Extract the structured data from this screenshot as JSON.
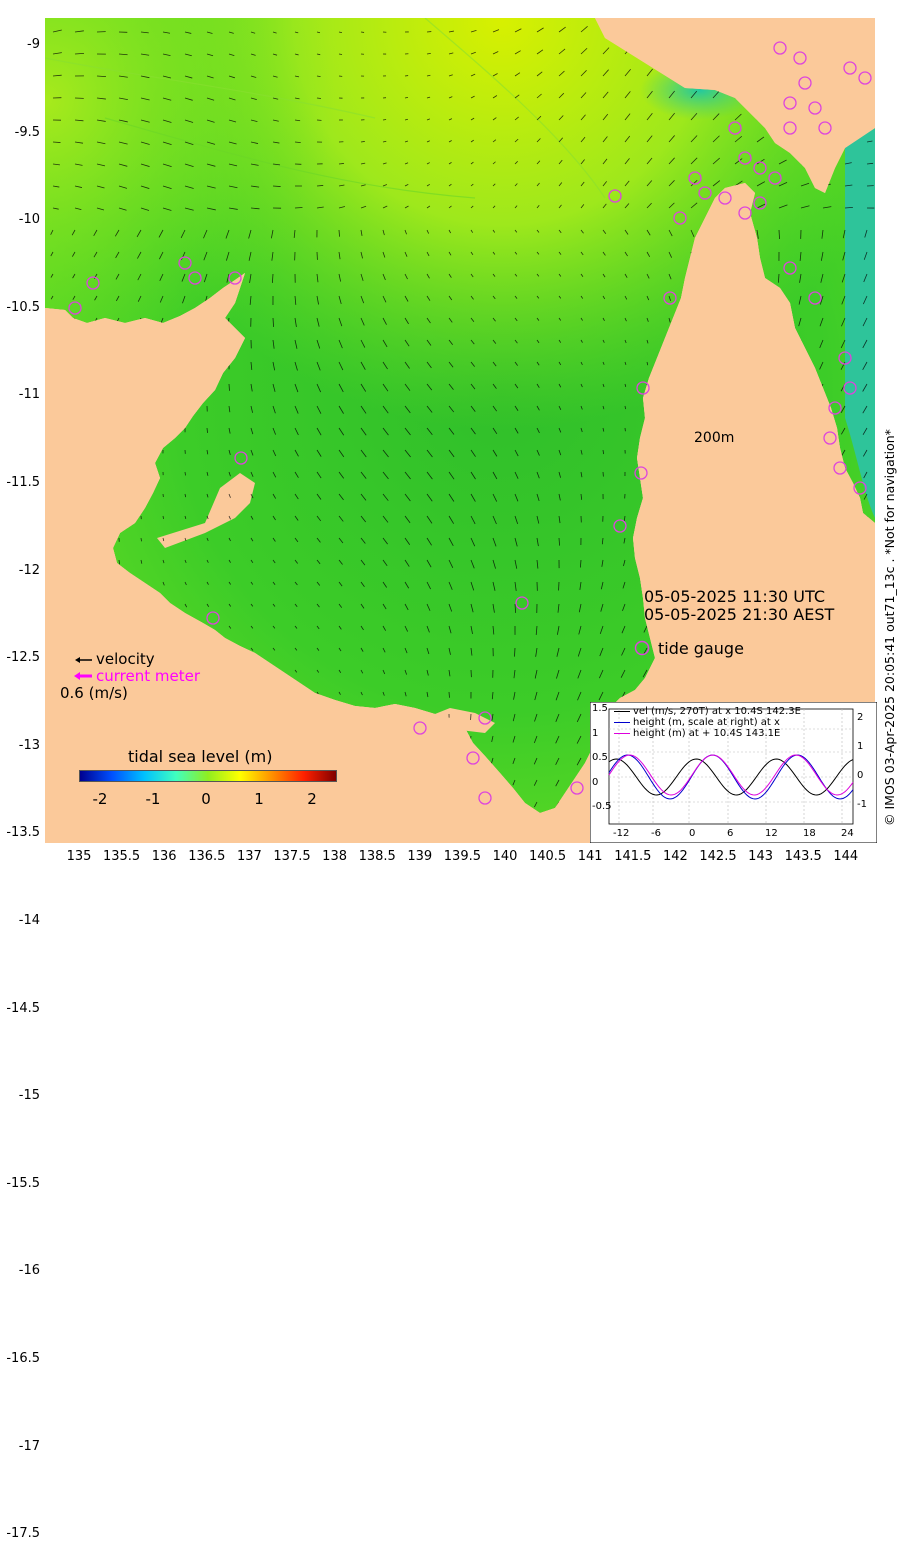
{
  "map": {
    "y_ticks": [
      "-9",
      "-9.5",
      "-10",
      "-10.5",
      "-11",
      "-11.5",
      "-12",
      "-12.5",
      "-13",
      "-13.5",
      "-14",
      "-14.5",
      "-15",
      "-15.5",
      "-16",
      "-16.5",
      "-17",
      "-17.5"
    ],
    "x_ticks": [
      "135",
      "135.5",
      "136",
      "136.5",
      "137",
      "137.5",
      "138",
      "138.5",
      "139",
      "139.5",
      "140",
      "140.5",
      "141",
      "141.5",
      "142",
      "142.5",
      "143",
      "143.5",
      "144"
    ],
    "lat_range": [
      -18.0,
      -8.75
    ],
    "lon_range": [
      134.7,
      144.2
    ],
    "scale_label": "200m",
    "timestamp_utc": "05-05-2025 11:30 UTC",
    "timestamp_local": "05-05-2025 21:30 AEST",
    "legend": {
      "tide_gauge": "tide gauge",
      "velocity": "velocity",
      "current_meter": "current meter",
      "speed_scale": "0.6 (m/s)"
    },
    "colorbar": {
      "title": "tidal sea level (m)",
      "ticks": [
        "-2",
        "-1",
        "0",
        "1",
        "2"
      ],
      "range": [
        -2.5,
        2.5
      ],
      "colors": [
        "#00008f",
        "#0050ff",
        "#00c0ff",
        "#40ffbf",
        "#90ee20",
        "#ffff00",
        "#ff9000",
        "#ff2000",
        "#800000"
      ]
    },
    "colors": {
      "land": "#fbc99a",
      "sea_level_zero": "#33cc22",
      "gauge_ring": "#dd44dd",
      "current_meter": "#ff00ff"
    },
    "credit": "© IMOS 03-Apr-2025 20:05:41 out71_13c . *Not for navigation*"
  },
  "inset": {
    "legend": [
      {
        "label": "vel (m/s, 270T) at x 10.4S 142.3E",
        "color": "#000000"
      },
      {
        "label": "height (m, scale at right) at x",
        "color": "#0000cc"
      },
      {
        "label": "height (m) at + 10.4S 143.1E",
        "color": "#dd00dd"
      }
    ],
    "x_ticks": [
      "-12",
      "-6",
      "0",
      "6",
      "12",
      "18",
      "24"
    ],
    "left_ticks": [
      "1.5",
      "1",
      "0.5",
      "0",
      "-0.5"
    ],
    "right_ticks": [
      "2",
      "1",
      "0",
      "-1"
    ]
  }
}
